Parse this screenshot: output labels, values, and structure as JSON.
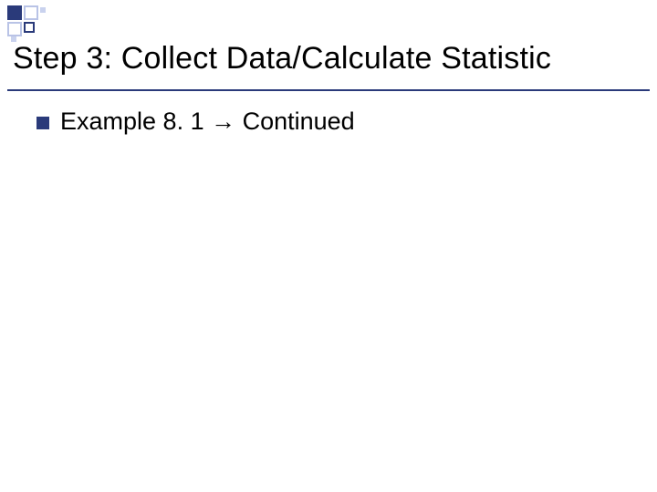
{
  "title": "Step 3: Collect Data/Calculate Statistic",
  "bullets": [
    {
      "prefix": "Example 8. 1 ",
      "arrow": "→",
      "suffix": " Continued"
    }
  ]
}
